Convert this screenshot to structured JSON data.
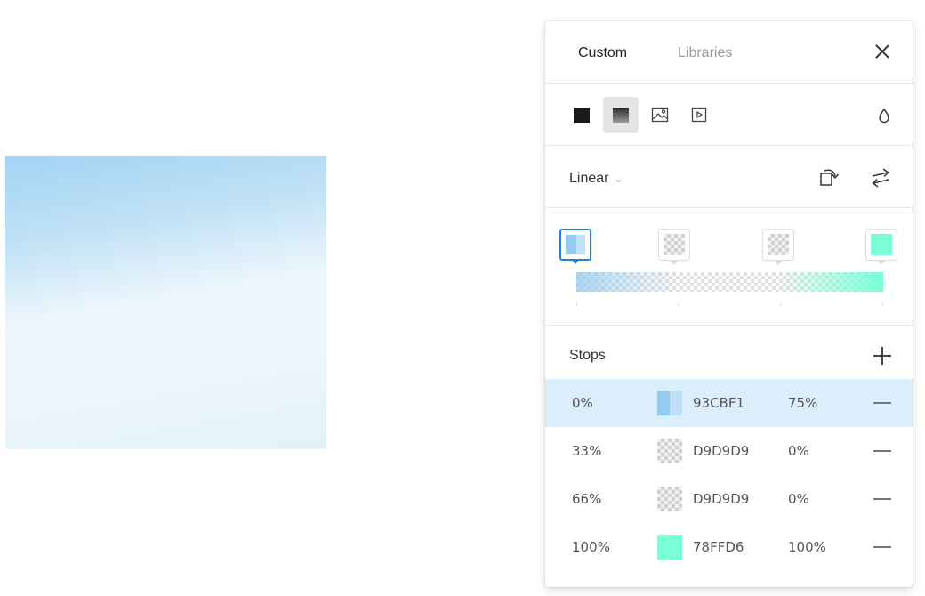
{
  "canvas": {
    "fill_start": "#93CBF1",
    "fill_end": "#78FFD6"
  },
  "panel": {
    "tabs": [
      {
        "label": "Custom",
        "active": true
      },
      {
        "label": "Libraries",
        "active": false
      }
    ],
    "fill_types": [
      {
        "name": "solid",
        "icon": "solid-fill-icon"
      },
      {
        "name": "gradient",
        "icon": "gradient-fill-icon",
        "active": true
      },
      {
        "name": "image",
        "icon": "image-fill-icon"
      },
      {
        "name": "video",
        "icon": "video-fill-icon"
      }
    ],
    "gradient_type": "Linear",
    "stops_title": "Stops",
    "stops": [
      {
        "position": "0%",
        "hex": "93CBF1",
        "opacity": "75%",
        "color": "#93CBF1",
        "selected": true
      },
      {
        "position": "33%",
        "hex": "D9D9D9",
        "opacity": "0%",
        "color": "#D9D9D9",
        "selected": false
      },
      {
        "position": "66%",
        "hex": "D9D9D9",
        "opacity": "0%",
        "color": "#D9D9D9",
        "selected": false
      },
      {
        "position": "100%",
        "hex": "78FFD6",
        "opacity": "100%",
        "color": "#78FFD6",
        "selected": false
      }
    ]
  }
}
